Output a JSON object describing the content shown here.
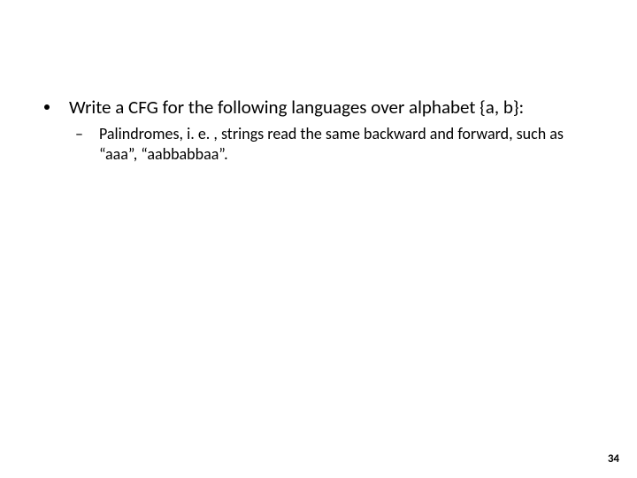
{
  "slide": {
    "bullet_main": "Write a CFG for the following languages over alphabet {a, b}:",
    "bullet_sub": "Palindromes, i. e. , strings read the same backward and forward, such as “aaa”, “aabbabbaa”.",
    "page_number": "34"
  }
}
